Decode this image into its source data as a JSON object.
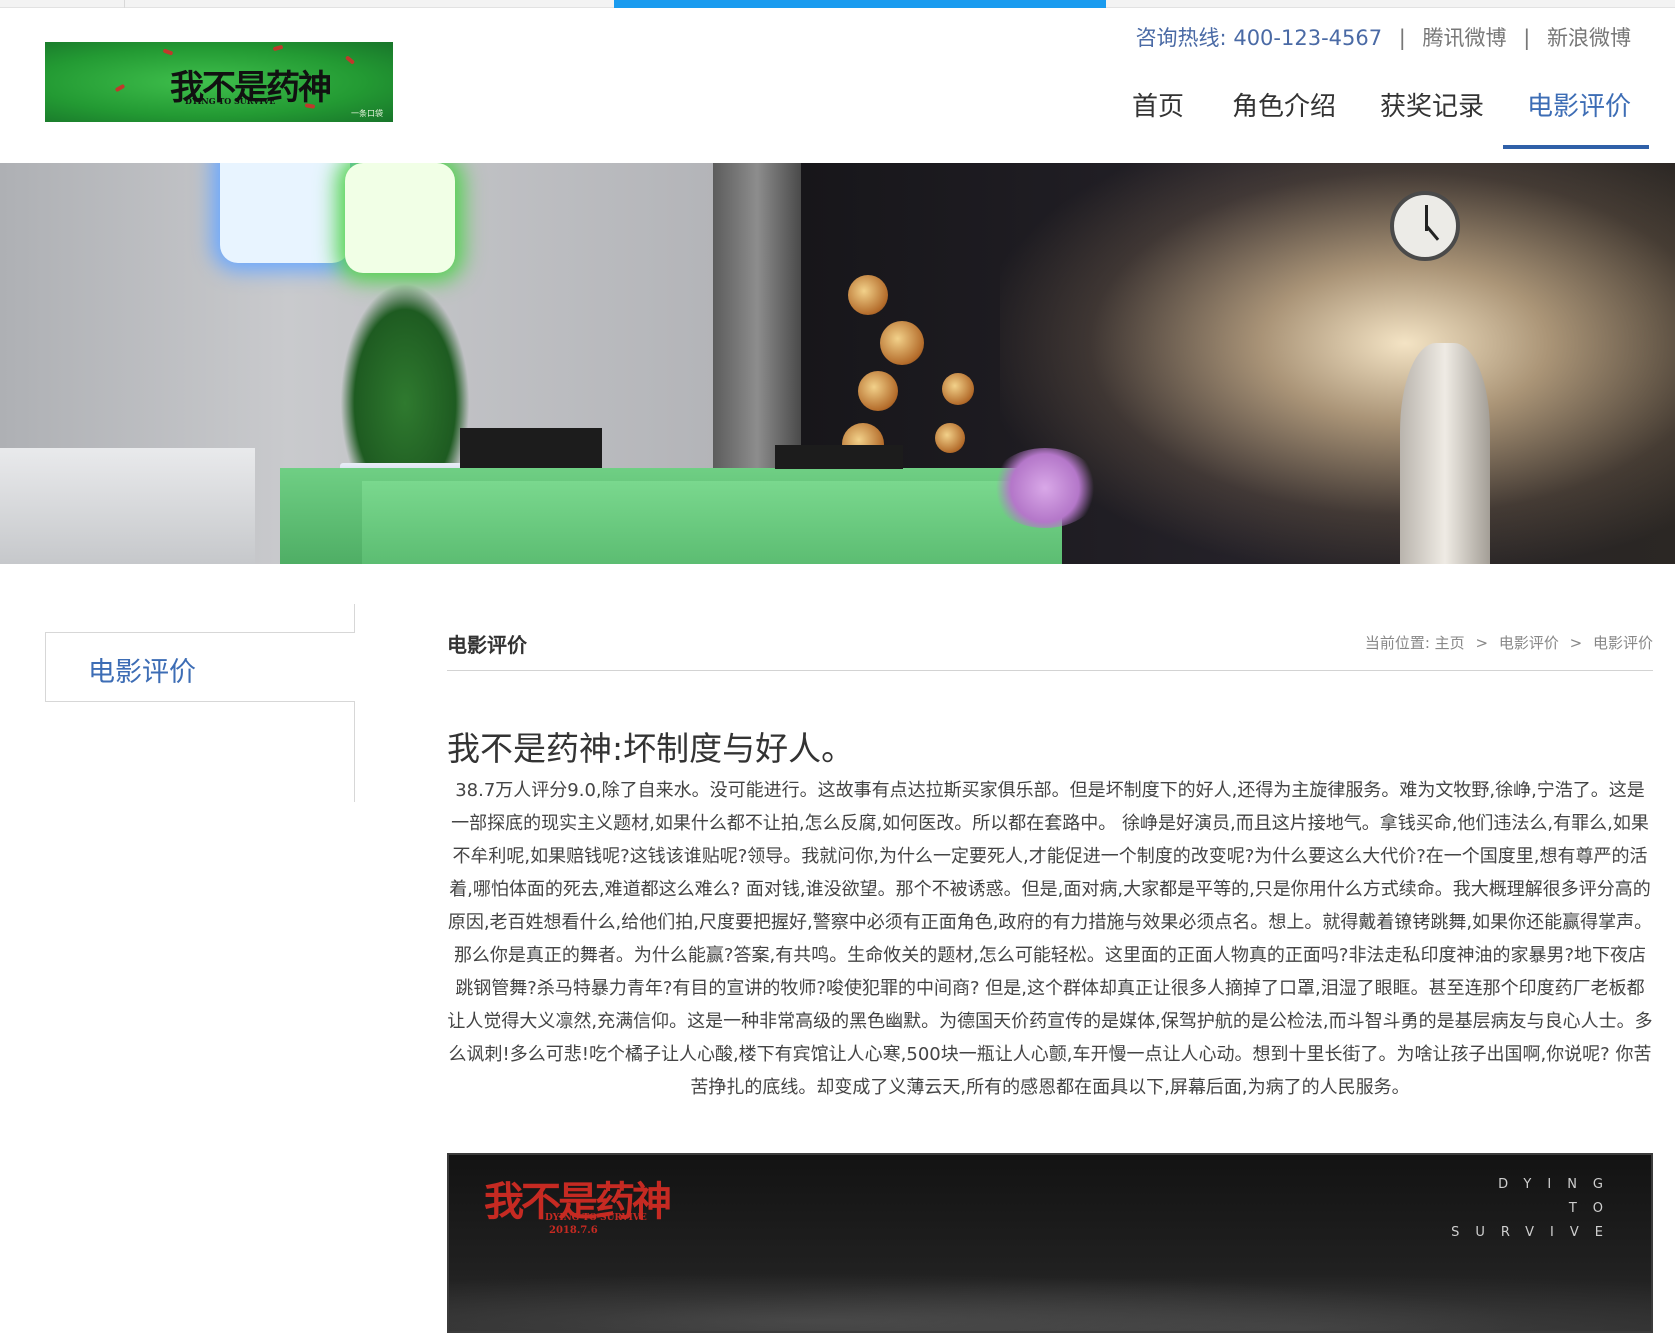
{
  "header": {
    "logo": {
      "title": "我不是药神",
      "subtitle": "DYING TO SURVIVE",
      "watermark": "一条口袋"
    },
    "hotline_label": "咨询热线:",
    "hotline_number": "400-123-4567",
    "separator": "|",
    "weibo_tencent": "腾讯微博",
    "weibo_sina": "新浪微博"
  },
  "progress": {
    "value": 0.25
  },
  "nav": {
    "items": [
      {
        "label": "首页",
        "active": false
      },
      {
        "label": "角色介绍",
        "active": false
      },
      {
        "label": "获奖记录",
        "active": false
      },
      {
        "label": "电影评价",
        "active": true
      }
    ]
  },
  "sidebar": {
    "current": "电影评价"
  },
  "content": {
    "section_title": "电影评价",
    "breadcrumb": {
      "prefix": "当前位置:",
      "items": [
        "主页",
        "电影评价",
        "电影评价"
      ],
      "separator": ">"
    },
    "article": {
      "title": "我不是药神:坏制度与好人。",
      "body": "38.7万人评分9.0,除了自来水。没可能进行。这故事有点达拉斯买家俱乐部。但是坏制度下的好人,还得为主旋律服务。难为文牧野,徐峥,宁浩了。这是一部探底的现实主义题材,如果什么都不让拍,怎么反腐,如何医改。所以都在套路中。 徐峥是好演员,而且这片接地气。拿钱买命,他们违法么,有罪么,如果不牟利呢,如果赔钱呢?这钱该谁贴呢?领导。我就问你,为什么一定要死人,才能促进一个制度的改变呢?为什么要这么大代价?在一个国度里,想有尊严的活着,哪怕体面的死去,难道都这么难么? 面对钱,谁没欲望。那个不被诱惑。但是,面对病,大家都是平等的,只是你用什么方式续命。我大概理解很多评分高的原因,老百姓想看什么,给他们拍,尺度要把握好,警察中必须有正面角色,政府的有力措施与效果必须点名。想上。就得戴着镣铐跳舞,如果你还能赢得掌声。那么你是真正的舞者。为什么能赢?答案,有共鸣。生命攸关的题材,怎么可能轻松。这里面的正面人物真的正面吗?非法走私印度神油的家暴男?地下夜店跳钢管舞?杀马特暴力青年?有目的宣讲的牧师?唆使犯罪的中间商? 但是,这个群体却真正让很多人摘掉了口罩,泪湿了眼眶。甚至连那个印度药厂老板都让人觉得大义凛然,充满信仰。这是一种非常高级的黑色幽默。为德国天价药宣传的是媒体,保驾护航的是公检法,而斗智斗勇的是基层病友与良心人士。多么讽刺!多么可悲!吃个橘子让人心酸,楼下有宾馆让人心寒,500块一瓶让人心颤,车开慢一点让人心动。想到十里长街了。为啥让孩子出国啊,你说呢? 你苦苦挣扎的底线。却变成了义薄云天,所有的感恩都在面具以下,屏幕后面,为病了的人民服务。"
    },
    "poster": {
      "title": "我不是药神",
      "subtitle": "DYING TO SURVIVE",
      "date": "2018.7.6",
      "english_lines": [
        "DYING",
        "TO",
        "SURVIVE"
      ]
    }
  },
  "colors": {
    "accent": "#3d6db5",
    "nav_underline": "#2f60a8",
    "progress": "#1a9bef",
    "poster_red": "#c62a22"
  }
}
